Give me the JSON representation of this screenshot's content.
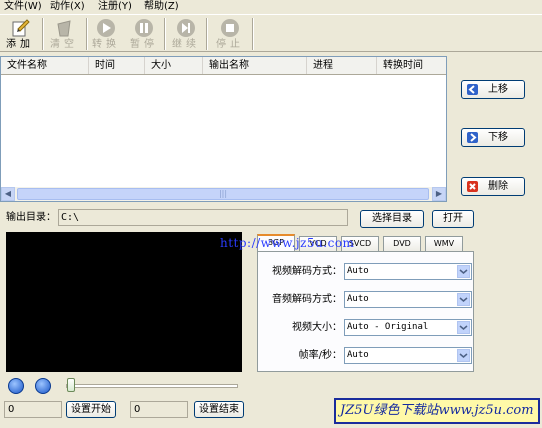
{
  "menu": [
    "文件(W)",
    "动作(X)",
    "注册(Y)",
    "帮助(Z)"
  ],
  "toolbar": {
    "add": "添加",
    "clear": "清空",
    "convert": "转换",
    "pause": "暂停",
    "resume": "继续",
    "stop": "停止"
  },
  "table": {
    "columns": [
      "文件名称",
      "时间",
      "大小",
      "输出名称",
      "进程",
      "转换时间"
    ]
  },
  "side_buttons": {
    "up": "上移",
    "down": "下移",
    "delete": "删除"
  },
  "output": {
    "label": "输出目录：",
    "path": "C:\\",
    "choose_label": "选择目录",
    "open_label": "打开"
  },
  "watermark_url": "http://www.jz5u.com",
  "tabs": [
    "3GP",
    "VCD",
    "SVCD",
    "DVD",
    "WMV"
  ],
  "settings": {
    "video_codec_label": "视频解码方式：",
    "video_codec_value": "Auto",
    "audio_codec_label": "音频解码方式：",
    "audio_codec_value": "Auto",
    "video_size_label": "视频大小：",
    "video_size_value": "Auto - Original",
    "fps_label": "帧率/秒：",
    "fps_value": "Auto"
  },
  "player": {
    "start_value": "0",
    "set_start_label": "设置开始",
    "end_value": "0",
    "set_end_label": "设置结束"
  },
  "brand_banner": "JZ5U绿色下载站www.jz5u.com",
  "colors": {
    "window_bg": "#ece9d8",
    "border_blue": "#003c74",
    "tab_accent": "#e68b2c",
    "link_blue": "#2a3cff"
  }
}
